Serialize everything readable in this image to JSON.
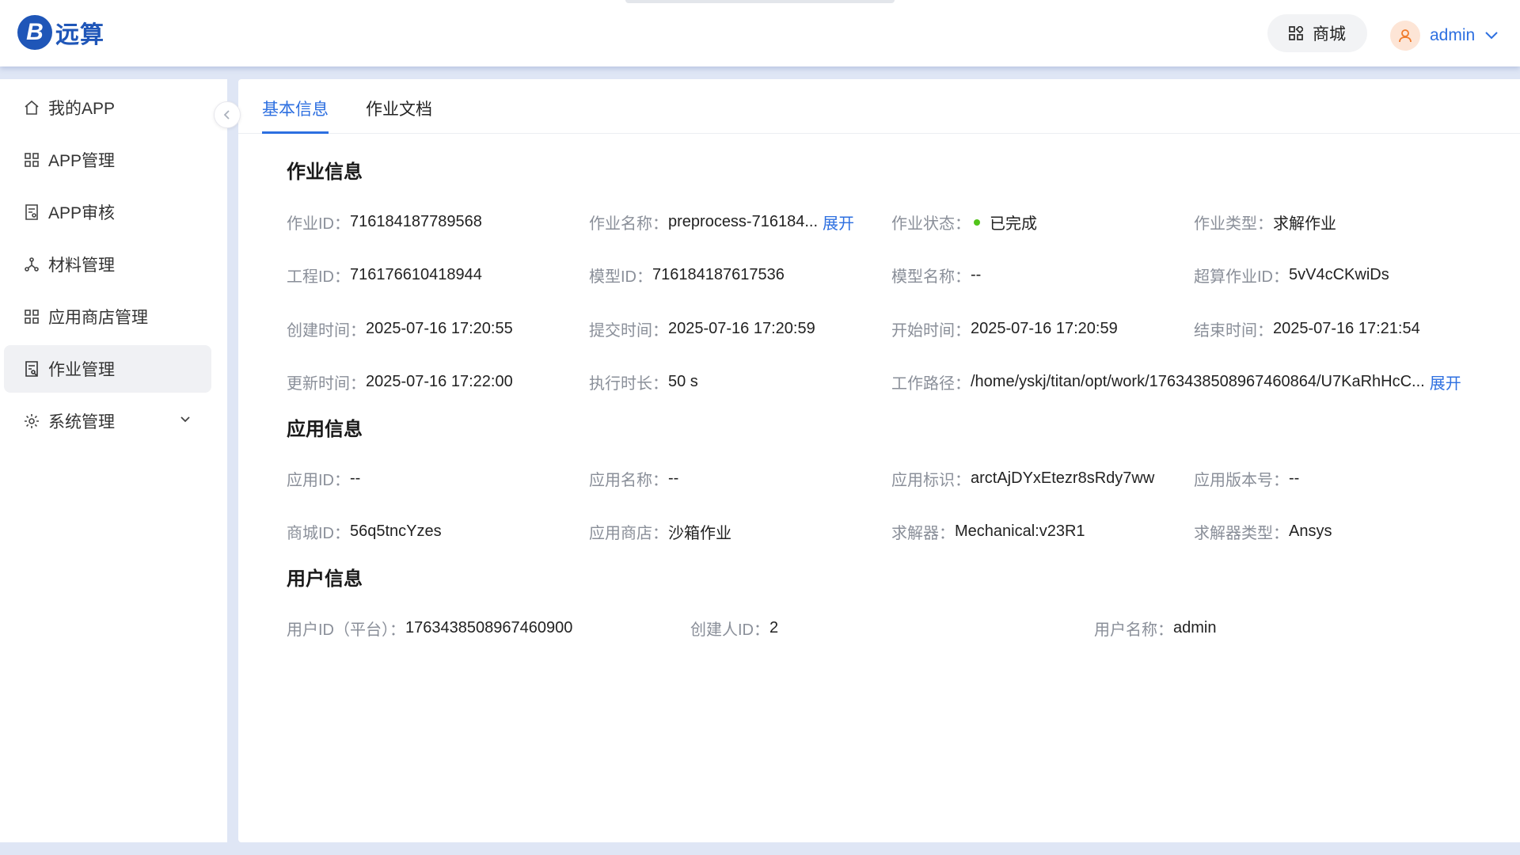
{
  "header": {
    "logo_mark": "B",
    "logo_text": "远算",
    "store_label": "商城",
    "username": "admin"
  },
  "sidebar": {
    "items": [
      {
        "label": "我的APP",
        "icon": "home-icon"
      },
      {
        "label": "APP管理",
        "icon": "grid-icon"
      },
      {
        "label": "APP审核",
        "icon": "audit-doc-icon"
      },
      {
        "label": "材料管理",
        "icon": "nodes-icon"
      },
      {
        "label": "应用商店管理",
        "icon": "grid-icon"
      },
      {
        "label": "作业管理",
        "icon": "job-doc-icon",
        "active": true
      },
      {
        "label": "系统管理",
        "icon": "gear-icon",
        "expandable": true
      }
    ]
  },
  "tabs": [
    {
      "label": "基本信息",
      "active": true
    },
    {
      "label": "作业文档"
    }
  ],
  "sections": {
    "job": {
      "title": "作业信息",
      "job_id_k": "作业ID：",
      "job_id": "716184187789568",
      "job_name_k": "作业名称：",
      "job_name": "preprocess-716184...",
      "job_name_expand": "展开",
      "status_k": "作业状态：",
      "status": "已完成",
      "type_k": "作业类型：",
      "type": "求解作业",
      "project_id_k": "工程ID：",
      "project_id": "716176610418944",
      "model_id_k": "模型ID：",
      "model_id": "716184187617536",
      "model_name_k": "模型名称：",
      "model_name": "--",
      "hpc_job_id_k": "超算作业ID：",
      "hpc_job_id": "5vV4cCKwiDs",
      "created_k": "创建时间：",
      "created": "2025-07-16 17:20:55",
      "submitted_k": "提交时间：",
      "submitted": "2025-07-16 17:20:59",
      "started_k": "开始时间：",
      "started": "2025-07-16 17:20:59",
      "ended_k": "结束时间：",
      "ended": "2025-07-16 17:21:54",
      "updated_k": "更新时间：",
      "updated": "2025-07-16 17:22:00",
      "duration_k": "执行时长：",
      "duration": "50 s",
      "work_path_k": "工作路径：",
      "work_path": "/home/yskj/titan/opt/work/1763438508967460864/U7KaRhHcC...",
      "work_path_expand": "展开"
    },
    "app": {
      "title": "应用信息",
      "app_id_k": "应用ID：",
      "app_id": "--",
      "app_name_k": "应用名称：",
      "app_name": "--",
      "app_key_k": "应用标识：",
      "app_key": "arctAjDYxEtezr8sRdy7ww",
      "app_version_k": "应用版本号：",
      "app_version": "--",
      "mall_id_k": "商城ID：",
      "mall_id": "56q5tncYzes",
      "app_store_k": "应用商店：",
      "app_store": "沙箱作业",
      "solver_k": "求解器：",
      "solver": "Mechanical:v23R1",
      "solver_type_k": "求解器类型：",
      "solver_type": "Ansys"
    },
    "user": {
      "title": "用户信息",
      "platform_user_id_k": "用户ID（平台）：",
      "platform_user_id": "1763438508967460900",
      "creator_id_k": "创建人ID：",
      "creator_id": "2",
      "user_name_k": "用户名称：",
      "user_name": "admin"
    }
  },
  "colors": {
    "accent": "#2d6fe0",
    "brand": "#1f56b8",
    "status_done": "#52c41a"
  }
}
